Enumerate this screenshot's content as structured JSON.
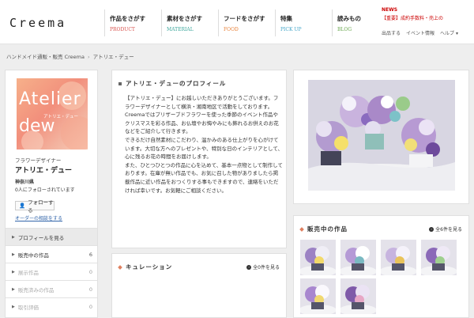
{
  "header": {
    "logo": "Creema",
    "nav": [
      {
        "label": "作品をさがす",
        "sub": "PRODUCT",
        "color": "#d9534f"
      },
      {
        "label": "素材をさがす",
        "sub": "MATERIAL",
        "color": "#3aa69b"
      },
      {
        "label": "フードをさがす",
        "sub": "FOOD",
        "color": "#e8823a"
      },
      {
        "label": "特集",
        "sub": "PICK UP",
        "color": "#45a6c9"
      },
      {
        "label": "読みもの",
        "sub": "BLOG",
        "color": "#6aa84f"
      }
    ],
    "news_label": "NEWS",
    "news_line": "【重要】成約手数料・売上の",
    "links": [
      "出品する",
      "イベント情報",
      "ヘルプ ▾"
    ]
  },
  "breadcrumb": [
    "ハンドメイド通販・販売 Creema",
    "アトリエ・デュー"
  ],
  "shop": {
    "image_text_1": "Atelier",
    "image_text_2": "dew",
    "image_sub": "アトリエ・デュー",
    "role": "フラワーデザイナー",
    "name": "アトリエ・デュー",
    "location": "神奈川県",
    "followers": "0人にフォローされています",
    "follow_label": "フォローする",
    "order_link": "オーダーの相談をする"
  },
  "menu": [
    {
      "label": "プロフィールを見る",
      "count": "",
      "active": true,
      "dim": false
    },
    {
      "label": "販売中の作品",
      "count": "6",
      "active": false,
      "dim": false
    },
    {
      "label": "展示作品",
      "count": "0",
      "active": false,
      "dim": true
    },
    {
      "label": "販売済みの作品",
      "count": "0",
      "active": false,
      "dim": true
    },
    {
      "label": "取引評価",
      "count": "0",
      "active": false,
      "dim": true
    }
  ],
  "profile": {
    "title": "アトリエ・デューのプロフィール",
    "body": "【アトリエ・デュー】にお越しいただきありがとうございます。フラワーデザイナーとして横浜・湘南地区で活動をしております。\nCreemaではプリザーブドフラワーを使った季節のイベント作品やクリスマスを彩る作品、お仏壇やお悔やみにも飾れるお供えのお花などをご紹介して行きます。\nできるだけ自然素材にこだわり、温かみのある仕上がりを心がけています。大切な方へのプレゼントや、特別な日のインテリアとして、心に残るお花の時間をお届けします。\nまた、ひとつひとつの作品に心を込めて、基本一点物として制作しております。在庫が無い作品でも、お気に召した物がありましたら掲載作品に近い作品をおつくりする事もできますので、連絡をいただければ幸いです。お気軽にご相談ください。"
  },
  "curation": {
    "title": "キュレーション",
    "see_all": "全0件を見る"
  },
  "forsale": {
    "title": "販売中の作品",
    "see_all": "全6件を見る",
    "count": 6
  }
}
